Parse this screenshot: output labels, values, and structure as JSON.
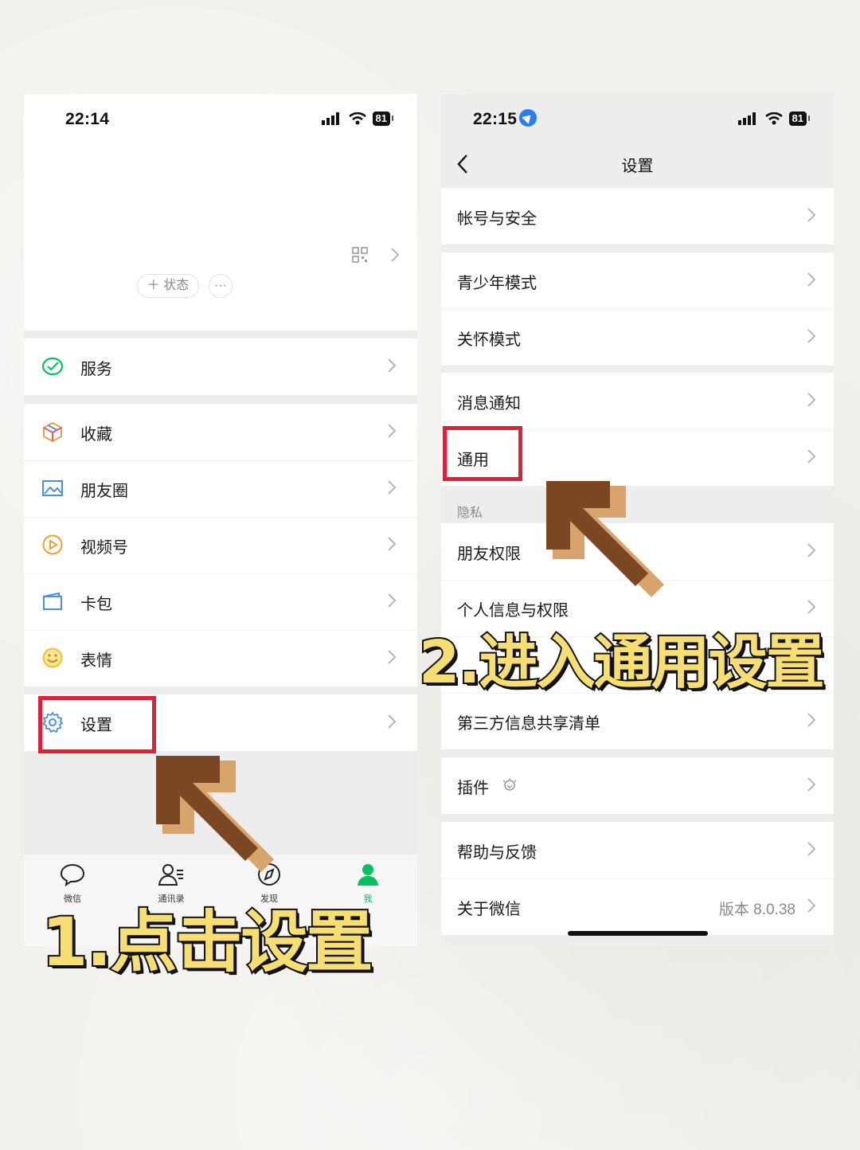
{
  "left_phone": {
    "status": {
      "time": "22:14",
      "battery": "81"
    },
    "profile": {
      "status_button": "＋ 状态",
      "more_button": "···"
    },
    "menu": [
      {
        "label": "服务",
        "icon": "wechat-pay-icon"
      },
      {
        "label": "收藏",
        "icon": "favorites-cube-icon"
      },
      {
        "label": "朋友圈",
        "icon": "moments-image-icon"
      },
      {
        "label": "视频号",
        "icon": "channels-play-icon"
      },
      {
        "label": "卡包",
        "icon": "card-wallet-icon"
      },
      {
        "label": "表情",
        "icon": "sticker-smile-icon"
      },
      {
        "label": "设置",
        "icon": "gear-icon"
      }
    ],
    "tabs": [
      {
        "label": "微信",
        "icon": "chat-bubble-icon"
      },
      {
        "label": "通讯录",
        "icon": "contacts-icon"
      },
      {
        "label": "发现",
        "icon": "compass-icon"
      },
      {
        "label": "我",
        "icon": "person-icon"
      }
    ]
  },
  "right_phone": {
    "status": {
      "time": "22:15",
      "battery": "81"
    },
    "title": "设置",
    "items": {
      "account_security": "帐号与安全",
      "youth_mode": "青少年模式",
      "care_mode": "关怀模式",
      "notifications": "消息通知",
      "general": "通用",
      "privacy_header": "隐私",
      "friend_permissions": "朋友权限",
      "personal_info": "个人信息与权限",
      "third_party": "第三方信息共享清单",
      "plugins": "插件",
      "help": "帮助与反馈",
      "about": "关于微信",
      "version": "版本 8.0.38"
    }
  },
  "captions": {
    "step1": "1.点击设置",
    "step2": "2.进入通用设置"
  },
  "colors": {
    "highlight_red": "#e0203a",
    "caption_yellow": "#f6de72",
    "arrow_brown": "#7a4722",
    "arrow_tan": "#d9a46b",
    "wechat_green": "#07c160"
  }
}
